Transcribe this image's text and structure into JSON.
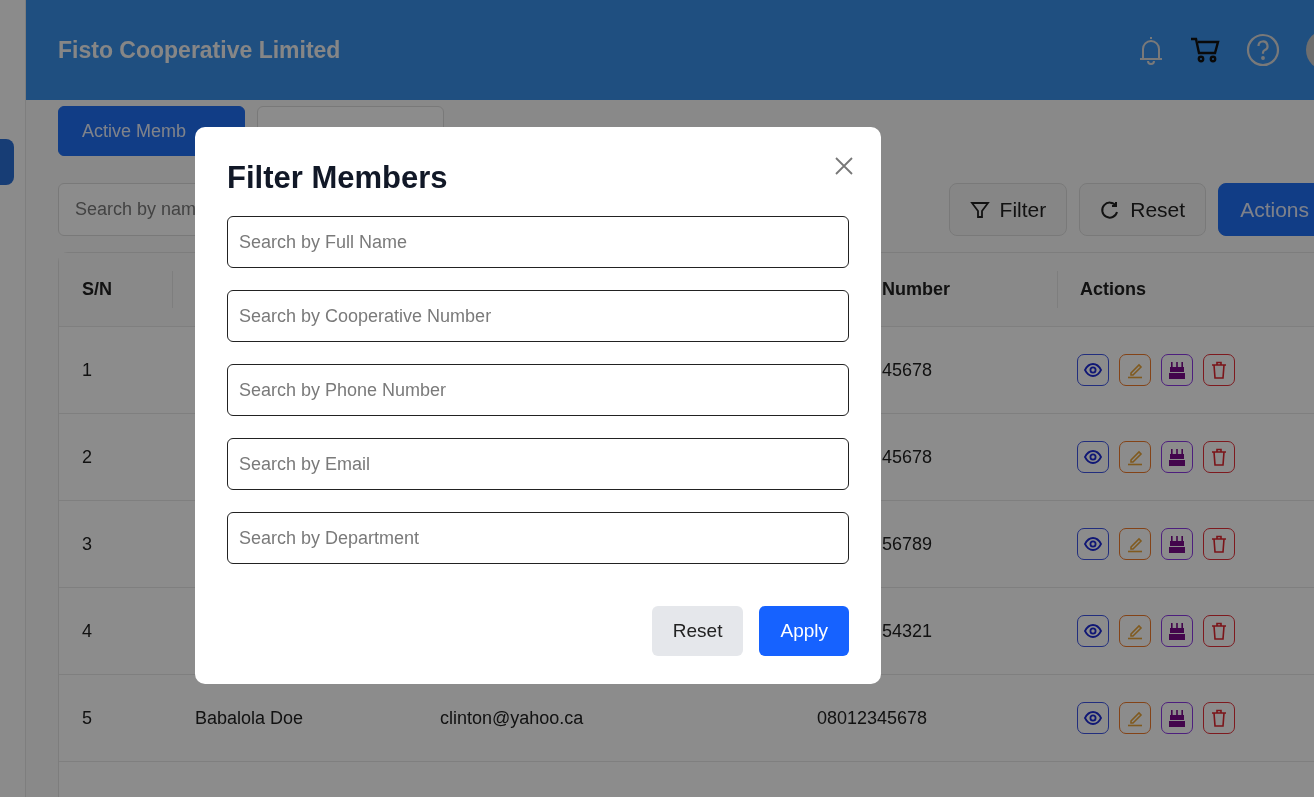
{
  "header": {
    "title": "Fisto Cooperative Limited"
  },
  "tabs": [
    {
      "label": "Active Memb",
      "selected": true
    },
    {
      "selected": false
    }
  ],
  "toolbar": {
    "search_placeholder": "Search by nam",
    "buttons": [
      "Filter",
      "Reset",
      "Actions"
    ]
  },
  "table": {
    "columns": [
      "S/N",
      "Number",
      "Actions"
    ],
    "rows": [
      {
        "sn": "1",
        "phone": "45678"
      },
      {
        "sn": "2",
        "phone": "45678"
      },
      {
        "sn": "3",
        "phone": "56789"
      },
      {
        "sn": "4",
        "phone": "54321"
      },
      {
        "sn": "5",
        "name": "Babalola Doe",
        "email": "clinton@yahoo.ca",
        "phone": "08012345678"
      }
    ]
  },
  "dialog": {
    "title": "Filter Members",
    "fields": [
      {
        "placeholder": "Search by Full Name"
      },
      {
        "placeholder": "Search by Cooperative Number"
      },
      {
        "placeholder": "Search by Phone Number"
      },
      {
        "placeholder": "Search by Email"
      },
      {
        "placeholder": "Search by Department"
      }
    ],
    "buttons": [
      {
        "label": "Reset",
        "kind": "secondary"
      },
      {
        "label": "Apply",
        "kind": "primary"
      }
    ]
  }
}
